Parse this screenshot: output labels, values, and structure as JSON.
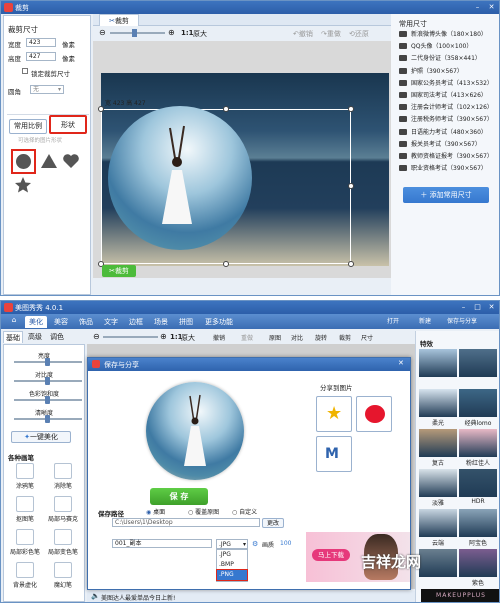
{
  "w1": {
    "title": "裁剪",
    "crop_tab": "裁剪",
    "ratio": "1:1",
    "zoom_label": "原大",
    "undo": "撤销",
    "redo": "重做",
    "reset": "还原",
    "section_title": "裁剪尺寸",
    "width_label": "宽度",
    "width_value": "423",
    "height_label": "高度",
    "height_value": "427",
    "unit": "像素",
    "lock_label": "锁定裁剪尺寸",
    "corner_label": "圆角",
    "corner_value": "无",
    "tab_common": "常用比例",
    "tab_shape": "形状",
    "hint": "可选择的图片形状",
    "size_readout": "宽 423 高 427",
    "crop_button": "裁剪",
    "right_title": "常用尺寸",
    "add_button": "添加常用尺寸",
    "sizes": [
      "新浪微博头像（180×180）",
      "QQ头像（100×100）",
      "二代身份证（358×441）",
      "护照（390×567）",
      "国家公务员考试（413×532）",
      "国家司法考试（413×626）",
      "注册会计师考试（102×126）",
      "注册税务师考试（390×567）",
      "日语能力考试（480×360）",
      "报关员考试（390×567）",
      "教师资格证报考（390×567）",
      "职业资格考试（390×567）"
    ]
  },
  "w2": {
    "title": "美图秀秀 4.0.1",
    "menu": [
      "美化",
      "美容",
      "饰品",
      "文字",
      "边框",
      "场景",
      "拼图",
      "更多功能"
    ],
    "right_tools": [
      "打开",
      "新建",
      "保存与分享"
    ],
    "subtabs": [
      "基础",
      "高级",
      "调色"
    ],
    "toolbar": [
      "撤销",
      "重做",
      "原图",
      "对比",
      "旋转",
      "裁剪",
      "尺寸"
    ],
    "ratio": "1:1",
    "zoom_label": "原大",
    "adjust": [
      "亮度",
      "对比度",
      "色彩饱和度",
      "清晰度"
    ],
    "one_key": "一键美化",
    "brush_title": "各种画笔",
    "brushes": [
      "涂鸦笔",
      "消除笔",
      "抠图笔",
      "局部马赛克",
      "局部彩色笔",
      "局部变色笔",
      "背景虚化",
      "魔幻笔"
    ],
    "effects_title": "特效",
    "effects": [
      "",
      "",
      "柔光",
      "经典lomo",
      "复古",
      "粉红佳人",
      "淡雅",
      "HDR",
      "云端",
      "阿宝色",
      "",
      "紫色"
    ],
    "status": "美图达人最爱单品今日上新!"
  },
  "dialog": {
    "title": "保存与分享",
    "share_title": "分享到图片",
    "save_button": "保 存",
    "path_title": "保存路径",
    "options": [
      "桌面",
      "覆盖原图",
      "自定义"
    ],
    "path_value": "C:\\Users\\1\\Desktop",
    "change_button": "更改",
    "filename": "001_副本",
    "format_selected": ".JPG",
    "formats": [
      ".JPG",
      ".BMP",
      ".PNG"
    ],
    "quality_label": "画质",
    "quality_value": "100",
    "ad_button": "马上下载",
    "watermark": "吉祥龙网",
    "brand": "MAKEUPPLUS"
  },
  "colors": {
    "titlebar": "#2c5ea9",
    "red_highlight": "#e0261a",
    "green": "#4cbb3a",
    "blue_button": "#3678cf"
  }
}
